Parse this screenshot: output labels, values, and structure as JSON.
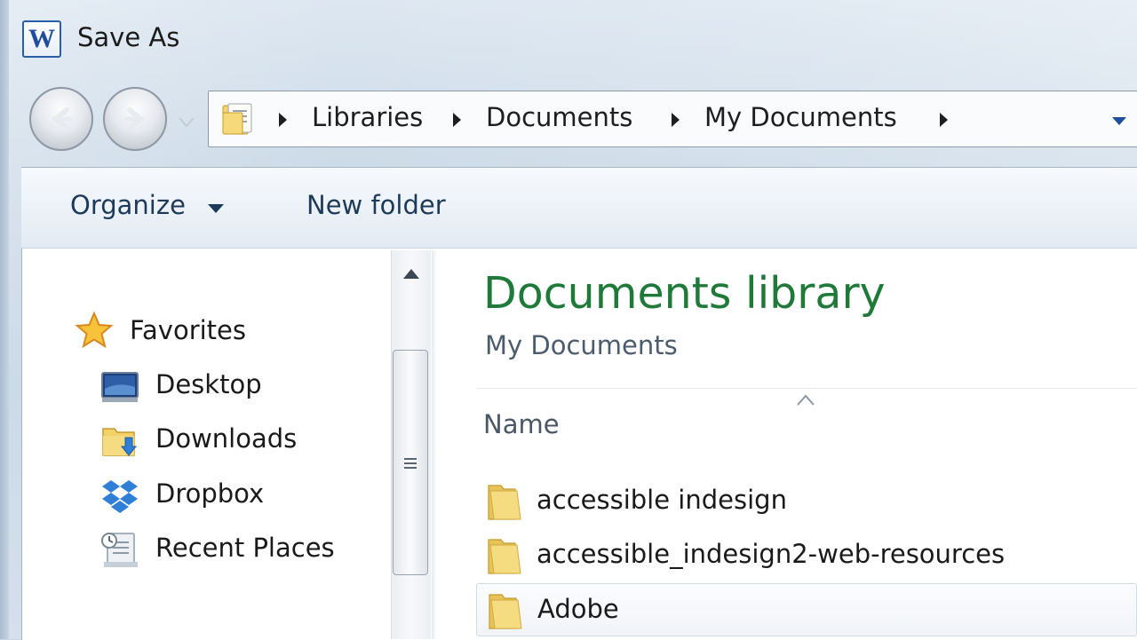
{
  "window": {
    "title": "Save As",
    "app_icon": "word-icon",
    "app_icon_letter": "W"
  },
  "navigation": {
    "back": "back-arrow-icon",
    "forward": "forward-arrow-icon",
    "recent": "chevron-down-icon"
  },
  "address_bar": {
    "crumbs": [
      "Libraries",
      "Documents",
      "My Documents"
    ]
  },
  "toolbar": {
    "organize_label": "Organize",
    "new_folder_label": "New folder"
  },
  "nav_pane": {
    "favorites_label": "Favorites",
    "items": [
      {
        "label": "Desktop",
        "icon": "desktop-icon"
      },
      {
        "label": "Downloads",
        "icon": "downloads-folder-icon"
      },
      {
        "label": "Dropbox",
        "icon": "dropbox-icon"
      },
      {
        "label": "Recent Places",
        "icon": "recent-places-icon"
      }
    ]
  },
  "content": {
    "library_title": "Documents library",
    "library_subtitle": "My Documents",
    "column_name": "Name",
    "files": [
      {
        "name": "accessible indesign",
        "type": "folder"
      },
      {
        "name": "accessible_indesign2-web-resources",
        "type": "folder"
      },
      {
        "name": "Adobe",
        "type": "folder",
        "selected": true
      }
    ]
  },
  "colors": {
    "library_title": "#1f7a3a",
    "toolbar_text": "#1e3a5a",
    "folder_yellow": "#f2d168"
  }
}
